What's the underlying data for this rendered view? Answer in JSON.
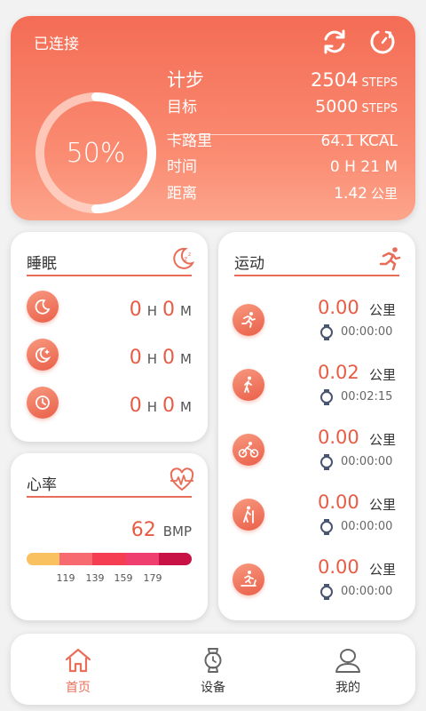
{
  "hero": {
    "connection": "已连接",
    "progress_percent": 50,
    "progress_label": "50%",
    "steps_label": "计步",
    "steps_value": "2504",
    "steps_unit": "STEPS",
    "goal_label": "目标",
    "goal_value": "5000",
    "goal_unit": "STEPS",
    "calories_label": "卡路里",
    "calories_value": "64.1 KCAL",
    "time_label": "时间",
    "time_value": "0 H 21 M",
    "distance_label": "距离",
    "distance_value": "1.42",
    "distance_unit": "公里"
  },
  "sleep": {
    "title": "睡眠",
    "rows": [
      {
        "h": "0",
        "h_unit": "H",
        "m": "0",
        "m_unit": "M"
      },
      {
        "h": "0",
        "h_unit": "H",
        "m": "0",
        "m_unit": "M"
      },
      {
        "h": "0",
        "h_unit": "H",
        "m": "0",
        "m_unit": "M"
      }
    ]
  },
  "heart": {
    "title": "心率",
    "value": "62",
    "unit": "BMP",
    "ticks": [
      "119",
      "139",
      "159",
      "179"
    ],
    "zone_colors": [
      "#f9c160",
      "#f76a6f",
      "#f53e52",
      "#ee3f6e",
      "#c81245"
    ]
  },
  "sport": {
    "title": "运动",
    "rows": [
      {
        "activity_icon": "running-icon",
        "distance": "0.00",
        "unit": "公里",
        "time": "00:00:00"
      },
      {
        "activity_icon": "walking-icon",
        "distance": "0.02",
        "unit": "公里",
        "time": "00:02:15"
      },
      {
        "activity_icon": "cycling-icon",
        "distance": "0.00",
        "unit": "公里",
        "time": "00:00:00"
      },
      {
        "activity_icon": "hiking-icon",
        "distance": "0.00",
        "unit": "公里",
        "time": "00:00:00"
      },
      {
        "activity_icon": "treadmill-icon",
        "distance": "0.00",
        "unit": "公里",
        "time": "00:00:00"
      }
    ]
  },
  "nav": {
    "home": "首页",
    "device": "设备",
    "me": "我的",
    "active_color": "#e8705a"
  }
}
